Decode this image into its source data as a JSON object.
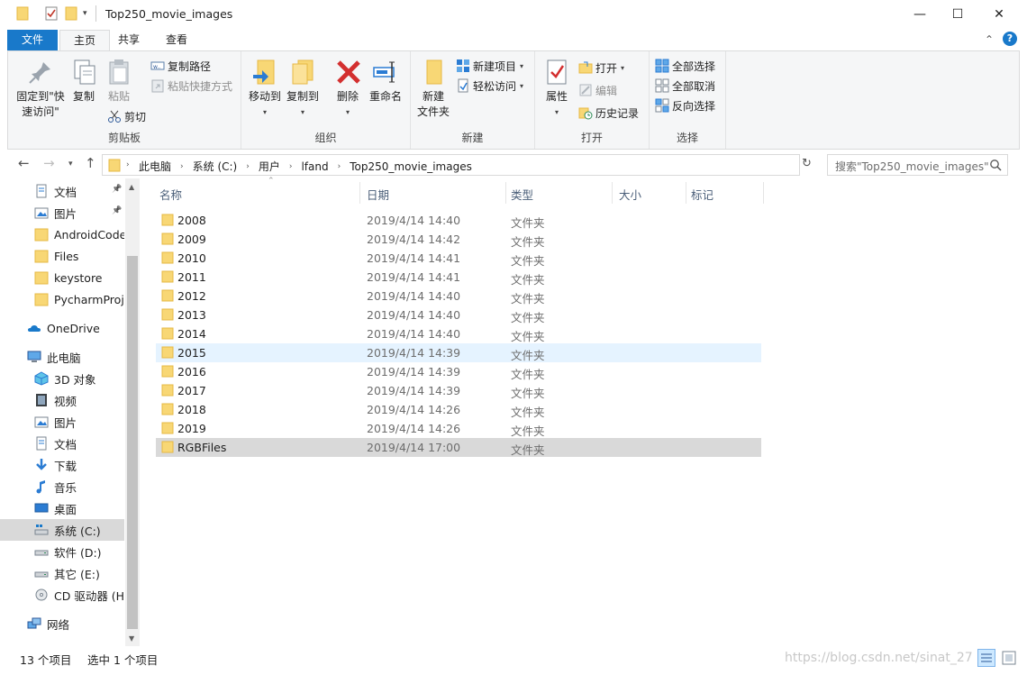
{
  "window": {
    "title": "Top250_movie_images",
    "minimize_glyph": "—",
    "maximize_glyph": "☐",
    "close_glyph": "✕"
  },
  "ribbon_tabs": [
    {
      "label": "文件",
      "kind": "file"
    },
    {
      "label": "主页",
      "active": true
    },
    {
      "label": "共享"
    },
    {
      "label": "查看"
    }
  ],
  "ribbon": {
    "clipboard": {
      "group_label": "剪贴板",
      "pin_quick_access": "固定到\"快\n速访问\"",
      "copy": "复制",
      "paste": "粘贴",
      "copy_path": "复制路径",
      "paste_shortcut": "粘贴快捷方式",
      "cut": "剪切"
    },
    "organize": {
      "group_label": "组织",
      "move_to": "移动到",
      "copy_to": "复制到",
      "delete": "删除",
      "rename": "重命名"
    },
    "new": {
      "group_label": "新建",
      "new_folder_line1": "新建",
      "new_folder_line2": "文件夹",
      "new_item": "新建项目",
      "easy_access": "轻松访问"
    },
    "open": {
      "group_label": "打开",
      "properties": "属性",
      "open": "打开",
      "edit": "编辑",
      "history": "历史记录"
    },
    "select": {
      "group_label": "选择",
      "select_all": "全部选择",
      "select_none": "全部取消",
      "invert": "反向选择"
    }
  },
  "address": {
    "crumbs": [
      "此电脑",
      "系统 (C:)",
      "用户",
      "lfand",
      "Top250_movie_images"
    ]
  },
  "search": {
    "placeholder": "搜索\"Top250_movie_images\""
  },
  "nav_pane": {
    "items": [
      {
        "label": "文档",
        "icon": "documents-icon",
        "pinned": true
      },
      {
        "label": "图片",
        "icon": "pictures-icon",
        "pinned": true
      },
      {
        "label": "AndroidCode",
        "icon": "folder-icon"
      },
      {
        "label": "Files",
        "icon": "folder-icon"
      },
      {
        "label": "keystore",
        "icon": "folder-icon"
      },
      {
        "label": "PycharmProje",
        "icon": "folder-icon"
      },
      {
        "label": "OneDrive",
        "icon": "onedrive-icon"
      },
      {
        "label": "此电脑",
        "icon": "this-pc-icon"
      },
      {
        "label": "3D 对象",
        "icon": "3d-objects-icon"
      },
      {
        "label": "视频",
        "icon": "videos-icon"
      },
      {
        "label": "图片",
        "icon": "pictures-icon"
      },
      {
        "label": "文档",
        "icon": "documents-icon"
      },
      {
        "label": "下载",
        "icon": "downloads-icon"
      },
      {
        "label": "音乐",
        "icon": "music-icon"
      },
      {
        "label": "桌面",
        "icon": "desktop-icon"
      },
      {
        "label": "系统 (C:)",
        "icon": "system-drive-icon",
        "selected": true
      },
      {
        "label": "软件 (D:)",
        "icon": "drive-icon"
      },
      {
        "label": "其它 (E:)",
        "icon": "drive-icon"
      },
      {
        "label": "CD 驱动器 (H:",
        "icon": "cd-drive-icon"
      },
      {
        "label": "网络",
        "icon": "network-icon"
      }
    ]
  },
  "columns": {
    "name": "名称",
    "date": "日期",
    "type": "类型",
    "size": "大小",
    "tags": "标记"
  },
  "files": [
    {
      "name": "2008",
      "date": "2019/4/14 14:40",
      "type": "文件夹"
    },
    {
      "name": "2009",
      "date": "2019/4/14 14:42",
      "type": "文件夹"
    },
    {
      "name": "2010",
      "date": "2019/4/14 14:41",
      "type": "文件夹"
    },
    {
      "name": "2011",
      "date": "2019/4/14 14:41",
      "type": "文件夹"
    },
    {
      "name": "2012",
      "date": "2019/4/14 14:40",
      "type": "文件夹"
    },
    {
      "name": "2013",
      "date": "2019/4/14 14:40",
      "type": "文件夹"
    },
    {
      "name": "2014",
      "date": "2019/4/14 14:40",
      "type": "文件夹"
    },
    {
      "name": "2015",
      "date": "2019/4/14 14:39",
      "type": "文件夹",
      "state": "hover"
    },
    {
      "name": "2016",
      "date": "2019/4/14 14:39",
      "type": "文件夹"
    },
    {
      "name": "2017",
      "date": "2019/4/14 14:39",
      "type": "文件夹"
    },
    {
      "name": "2018",
      "date": "2019/4/14 14:26",
      "type": "文件夹"
    },
    {
      "name": "2019",
      "date": "2019/4/14 14:26",
      "type": "文件夹"
    },
    {
      "name": "RGBFiles",
      "date": "2019/4/14 17:00",
      "type": "文件夹",
      "state": "selected"
    }
  ],
  "status": {
    "item_count": "13 个项目",
    "selection": "选中 1 个项目",
    "watermark": "https://blog.csdn.net/sinat_27"
  },
  "colors": {
    "accent": "#1979ca",
    "folder": "#f8d775",
    "folder_dark": "#e6b844",
    "hover_row": "#e5f3ff",
    "selected_row": "#d9d9d9"
  }
}
